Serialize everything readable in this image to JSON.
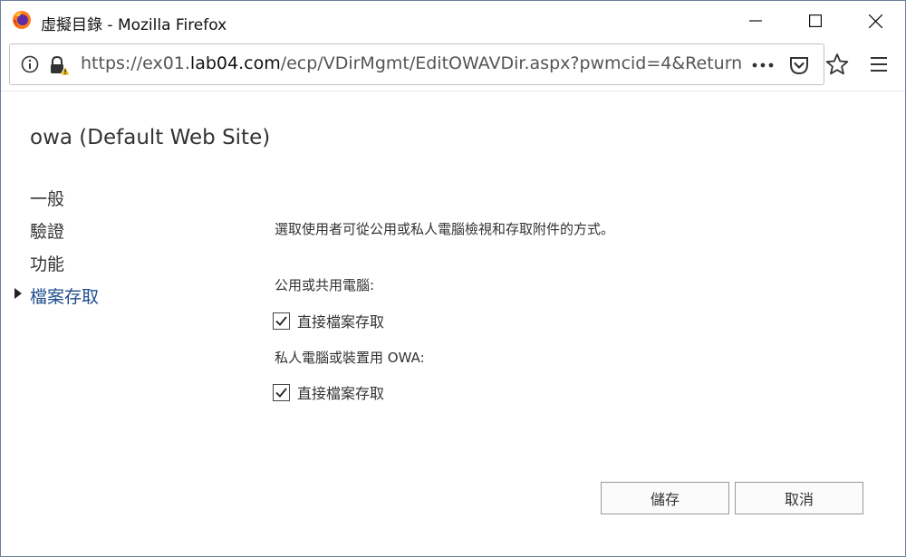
{
  "window": {
    "title": "虛擬目錄 - Mozilla Firefox",
    "buttons": {
      "minimize": "minimize",
      "maximize": "maximize",
      "close": "close"
    }
  },
  "urlbar": {
    "prefix": "https://ex01.",
    "domain": "lab04.com",
    "path": "/ecp/VDirMgmt/EditOWAVDir.aspx?pwmcid=4&Return",
    "icons": [
      "info-icon",
      "lock-warning-icon",
      "more-icon",
      "pocket-icon",
      "star-icon",
      "menu-icon"
    ]
  },
  "page": {
    "title": "owa (Default Web Site)",
    "nav": [
      {
        "label": "一般",
        "active": false
      },
      {
        "label": "驗證",
        "active": false
      },
      {
        "label": "功能",
        "active": false
      },
      {
        "label": "檔案存取",
        "active": true
      }
    ],
    "description": "選取使用者可從公用或私人電腦檢視和存取附件的方式。",
    "public_section": {
      "label": "公用或共用電腦:",
      "checkbox_label": "直接檔案存取",
      "checked": true
    },
    "private_section": {
      "label": "私人電腦或裝置用 OWA:",
      "checkbox_label": "直接檔案存取",
      "checked": true
    },
    "buttons": {
      "save": "儲存",
      "cancel": "取消"
    }
  },
  "colors": {
    "active_nav": "#1f4e8c",
    "frame_border": "#6a7f9a"
  }
}
